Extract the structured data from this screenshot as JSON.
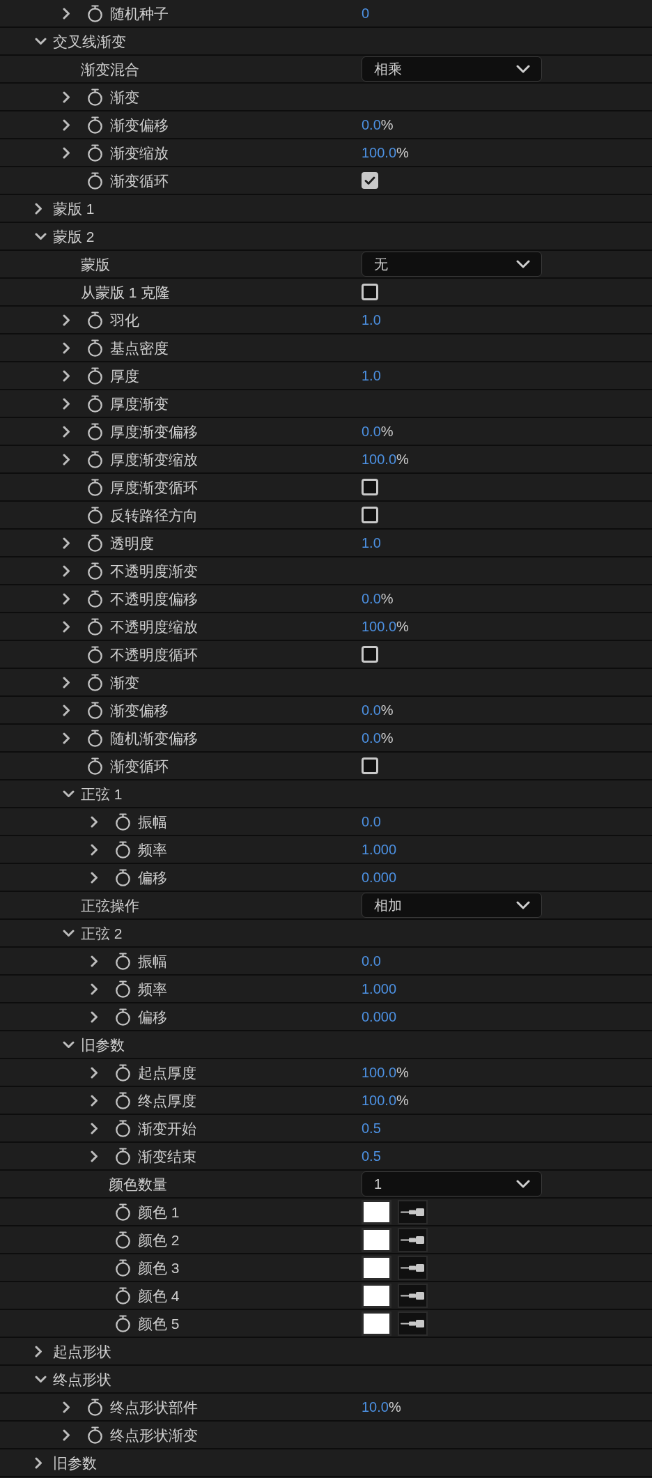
{
  "rows": [
    {
      "kind": "continued",
      "children": [
        {
          "kind": "property",
          "label": "随机种子",
          "stopwatch": true,
          "expanded": false,
          "control": {
            "kind": "number",
            "value": "0"
          }
        }
      ]
    },
    {
      "kind": "group",
      "label": "交叉线渐变",
      "expanded": true,
      "children": [
        {
          "kind": "property",
          "label": "渐变混合",
          "stopwatch": false,
          "control": {
            "kind": "dropdown",
            "value": "相乘"
          }
        },
        {
          "kind": "property",
          "label": "渐变",
          "stopwatch": true,
          "expanded": false
        },
        {
          "kind": "property",
          "label": "渐变偏移",
          "stopwatch": true,
          "expanded": false,
          "control": {
            "kind": "number",
            "value": "0.0",
            "unit": "%"
          }
        },
        {
          "kind": "property",
          "label": "渐变缩放",
          "stopwatch": true,
          "expanded": false,
          "control": {
            "kind": "number",
            "value": "100.0",
            "unit": "%"
          }
        },
        {
          "kind": "property",
          "label": "渐变循环",
          "stopwatch": true,
          "control": {
            "kind": "checkbox",
            "checked": true
          }
        }
      ]
    },
    {
      "kind": "group",
      "label": "蒙版 1",
      "expanded": false
    },
    {
      "kind": "group",
      "label": "蒙版 2",
      "expanded": true,
      "children": [
        {
          "kind": "property",
          "label": "蒙版",
          "stopwatch": false,
          "control": {
            "kind": "dropdown",
            "value": "无"
          }
        },
        {
          "kind": "property",
          "label": "从蒙版 1 克隆",
          "stopwatch": false,
          "control": {
            "kind": "checkbox",
            "checked": false
          }
        },
        {
          "kind": "property",
          "label": "羽化",
          "stopwatch": true,
          "expanded": false,
          "control": {
            "kind": "number",
            "value": "1.0"
          }
        },
        {
          "kind": "property",
          "label": "基点密度",
          "stopwatch": true,
          "expanded": false
        },
        {
          "kind": "property",
          "label": "厚度",
          "stopwatch": true,
          "expanded": false,
          "control": {
            "kind": "number",
            "value": "1.0"
          }
        },
        {
          "kind": "property",
          "label": "厚度渐变",
          "stopwatch": true,
          "expanded": false
        },
        {
          "kind": "property",
          "label": "厚度渐变偏移",
          "stopwatch": true,
          "expanded": false,
          "control": {
            "kind": "number",
            "value": "0.0",
            "unit": "%"
          }
        },
        {
          "kind": "property",
          "label": "厚度渐变缩放",
          "stopwatch": true,
          "expanded": false,
          "control": {
            "kind": "number",
            "value": "100.0",
            "unit": "%"
          }
        },
        {
          "kind": "property",
          "label": "厚度渐变循环",
          "stopwatch": true,
          "control": {
            "kind": "checkbox",
            "checked": false
          }
        },
        {
          "kind": "property",
          "label": "反转路径方向",
          "stopwatch": true,
          "control": {
            "kind": "checkbox",
            "checked": false
          }
        },
        {
          "kind": "property",
          "label": "透明度",
          "stopwatch": true,
          "expanded": false,
          "control": {
            "kind": "number",
            "value": "1.0"
          }
        },
        {
          "kind": "property",
          "label": "不透明度渐变",
          "stopwatch": true,
          "expanded": false
        },
        {
          "kind": "property",
          "label": "不透明度偏移",
          "stopwatch": true,
          "expanded": false,
          "control": {
            "kind": "number",
            "value": "0.0",
            "unit": "%"
          }
        },
        {
          "kind": "property",
          "label": "不透明度缩放",
          "stopwatch": true,
          "expanded": false,
          "control": {
            "kind": "number",
            "value": "100.0",
            "unit": "%"
          }
        },
        {
          "kind": "property",
          "label": "不透明度循环",
          "stopwatch": true,
          "control": {
            "kind": "checkbox",
            "checked": false
          }
        },
        {
          "kind": "property",
          "label": "渐变",
          "stopwatch": true,
          "expanded": false
        },
        {
          "kind": "property",
          "label": "渐变偏移",
          "stopwatch": true,
          "expanded": false,
          "control": {
            "kind": "number",
            "value": "0.0",
            "unit": "%"
          }
        },
        {
          "kind": "property",
          "label": "随机渐变偏移",
          "stopwatch": true,
          "expanded": false,
          "control": {
            "kind": "number",
            "value": "0.0",
            "unit": "%"
          }
        },
        {
          "kind": "property",
          "label": "渐变循环",
          "stopwatch": true,
          "control": {
            "kind": "checkbox",
            "checked": false
          }
        },
        {
          "kind": "group",
          "label": "正弦 1",
          "expanded": true,
          "children": [
            {
              "kind": "property",
              "label": "振幅",
              "stopwatch": true,
              "expanded": false,
              "control": {
                "kind": "number",
                "value": "0.0"
              }
            },
            {
              "kind": "property",
              "label": "频率",
              "stopwatch": true,
              "expanded": false,
              "control": {
                "kind": "number",
                "value": "1.000"
              }
            },
            {
              "kind": "property",
              "label": "偏移",
              "stopwatch": true,
              "expanded": false,
              "control": {
                "kind": "number",
                "value": "0.000"
              }
            }
          ]
        },
        {
          "kind": "property",
          "label": "正弦操作",
          "stopwatch": false,
          "control": {
            "kind": "dropdown",
            "value": "相加"
          }
        },
        {
          "kind": "group",
          "label": "正弦 2",
          "expanded": true,
          "children": [
            {
              "kind": "property",
              "label": "振幅",
              "stopwatch": true,
              "expanded": false,
              "control": {
                "kind": "number",
                "value": "0.0"
              }
            },
            {
              "kind": "property",
              "label": "频率",
              "stopwatch": true,
              "expanded": false,
              "control": {
                "kind": "number",
                "value": "1.000"
              }
            },
            {
              "kind": "property",
              "label": "偏移",
              "stopwatch": true,
              "expanded": false,
              "control": {
                "kind": "number",
                "value": "0.000"
              }
            }
          ]
        },
        {
          "kind": "group",
          "label": "旧参数",
          "expanded": true,
          "children": [
            {
              "kind": "property",
              "label": "起点厚度",
              "stopwatch": true,
              "expanded": false,
              "control": {
                "kind": "number",
                "value": "100.0",
                "unit": "%"
              }
            },
            {
              "kind": "property",
              "label": "终点厚度",
              "stopwatch": true,
              "expanded": false,
              "control": {
                "kind": "number",
                "value": "100.0",
                "unit": "%"
              }
            },
            {
              "kind": "property",
              "label": "渐变开始",
              "stopwatch": true,
              "expanded": false,
              "control": {
                "kind": "number",
                "value": "0.5"
              }
            },
            {
              "kind": "property",
              "label": "渐变结束",
              "stopwatch": true,
              "expanded": false,
              "control": {
                "kind": "number",
                "value": "0.5"
              }
            },
            {
              "kind": "property",
              "label": "颜色数量",
              "stopwatch": false,
              "control": {
                "kind": "dropdown",
                "value": "1"
              }
            },
            {
              "kind": "property",
              "label": "颜色 1",
              "stopwatch": true,
              "control": {
                "kind": "color",
                "color": "#ffffff"
              }
            },
            {
              "kind": "property",
              "label": "颜色 2",
              "stopwatch": true,
              "control": {
                "kind": "color",
                "color": "#ffffff"
              }
            },
            {
              "kind": "property",
              "label": "颜色 3",
              "stopwatch": true,
              "control": {
                "kind": "color",
                "color": "#ffffff"
              }
            },
            {
              "kind": "property",
              "label": "颜色 4",
              "stopwatch": true,
              "control": {
                "kind": "color",
                "color": "#ffffff"
              }
            },
            {
              "kind": "property",
              "label": "颜色 5",
              "stopwatch": true,
              "control": {
                "kind": "color",
                "color": "#ffffff"
              }
            }
          ]
        }
      ]
    },
    {
      "kind": "group",
      "label": "起点形状",
      "expanded": false
    },
    {
      "kind": "group",
      "label": "终点形状",
      "expanded": true,
      "children": [
        {
          "kind": "property",
          "label": "终点形状部件",
          "stopwatch": true,
          "expanded": false,
          "control": {
            "kind": "number",
            "value": "10.0",
            "unit": "%"
          }
        },
        {
          "kind": "property",
          "label": "终点形状渐变",
          "stopwatch": true,
          "expanded": false
        }
      ]
    },
    {
      "kind": "group",
      "label": "旧参数",
      "expanded": false
    }
  ]
}
